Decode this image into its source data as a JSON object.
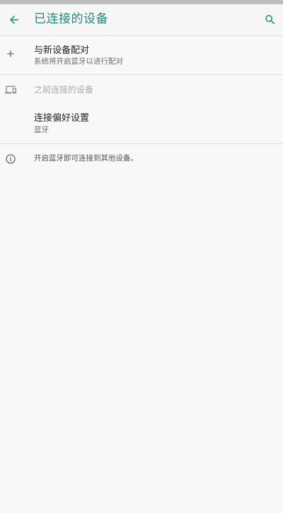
{
  "app_bar": {
    "title": "已连接的设备",
    "back_icon": "arrow-back-icon",
    "search_icon": "search-icon",
    "accent_color": "#1c8a7b"
  },
  "pair_new": {
    "icon": "plus-icon",
    "title": "与新设备配对",
    "subtitle": "系统将开启蓝牙以进行配对"
  },
  "previous_section": {
    "icon": "devices-icon",
    "header": "之前连接的设备"
  },
  "connection_prefs": {
    "title": "连接偏好设置",
    "subtitle": "蓝牙"
  },
  "footer_info": {
    "icon": "info-icon",
    "text": "开启蓝牙即可连接到其他设备。"
  }
}
